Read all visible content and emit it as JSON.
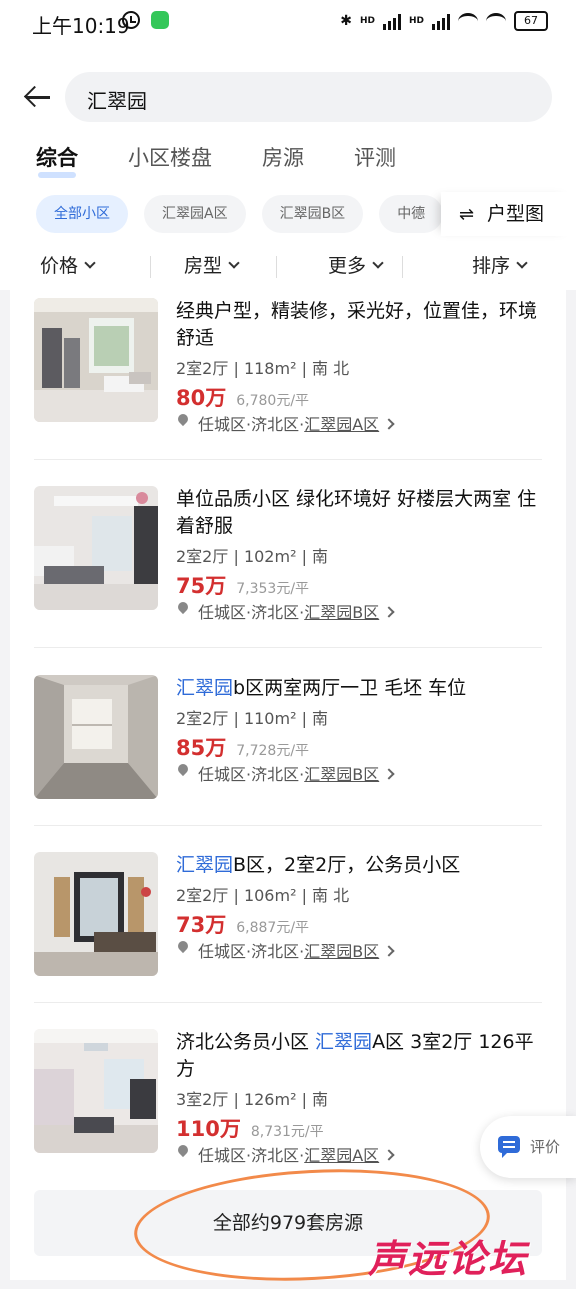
{
  "status_bar": {
    "time": "上午10:19",
    "battery": "67",
    "network_label": "HD"
  },
  "search": {
    "query": "汇翠园"
  },
  "tabs": [
    {
      "label": "综合",
      "active": true
    },
    {
      "label": "小区楼盘",
      "active": false
    },
    {
      "label": "房源",
      "active": false
    },
    {
      "label": "评测",
      "active": false
    }
  ],
  "chips": [
    {
      "label": "全部小区",
      "active": true
    },
    {
      "label": "汇翠园A区",
      "active": false
    },
    {
      "label": "汇翠园B区",
      "active": false
    },
    {
      "label": "中德",
      "active": false
    }
  ],
  "layout_button": {
    "icon": "swap-arrows-icon",
    "label": "户型图"
  },
  "filters": [
    {
      "label": "价格"
    },
    {
      "label": "房型"
    },
    {
      "label": "更多"
    },
    {
      "label": "排序"
    }
  ],
  "listings": [
    {
      "title_pre": "",
      "title_hl": "",
      "title_post": "经典户型，精装修，采光好，位置佳，环境舒适",
      "rooms": "2室2厅",
      "area": "118m²",
      "orientation": "南 北",
      "price": "80万",
      "unit_price": "6,780元/平",
      "district": "任城区",
      "area_name": "济北区",
      "community": "汇翠园A区"
    },
    {
      "title_pre": "",
      "title_hl": "",
      "title_post": "单位品质小区 绿化环境好 好楼层大两室 住着舒服",
      "rooms": "2室2厅",
      "area": "102m²",
      "orientation": "南",
      "price": "75万",
      "unit_price": "7,353元/平",
      "district": "任城区",
      "area_name": "济北区",
      "community": "汇翠园B区"
    },
    {
      "title_pre": "",
      "title_hl": "汇翠园",
      "title_post": "b区两室两厅一卫 毛坯 车位",
      "rooms": "2室2厅",
      "area": "110m²",
      "orientation": "南",
      "price": "85万",
      "unit_price": "7,728元/平",
      "district": "任城区",
      "area_name": "济北区",
      "community": "汇翠园B区"
    },
    {
      "title_pre": "",
      "title_hl": "汇翠园",
      "title_post": "B区，2室2厅，公务员小区",
      "rooms": "2室2厅",
      "area": "106m²",
      "orientation": "南 北",
      "price": "73万",
      "unit_price": "6,887元/平",
      "district": "任城区",
      "area_name": "济北区",
      "community": "汇翠园B区"
    },
    {
      "title_pre": "济北公务员小区 ",
      "title_hl": "汇翠园",
      "title_post": "A区 3室2厅 126平方",
      "rooms": "3室2厅",
      "area": "126m²",
      "orientation": "南",
      "price": "110万",
      "unit_price": "8,731元/平",
      "district": "任城区",
      "area_name": "济北区",
      "community": "汇翠园A区"
    }
  ],
  "all_listings_button": "全部约979套房源",
  "fab": {
    "label": "评价",
    "icon": "comment-icon"
  },
  "watermark": "声远论坛",
  "colors": {
    "accent": "#2f6bd8",
    "price": "#d32f2f",
    "annotation": "#f28a4a"
  }
}
